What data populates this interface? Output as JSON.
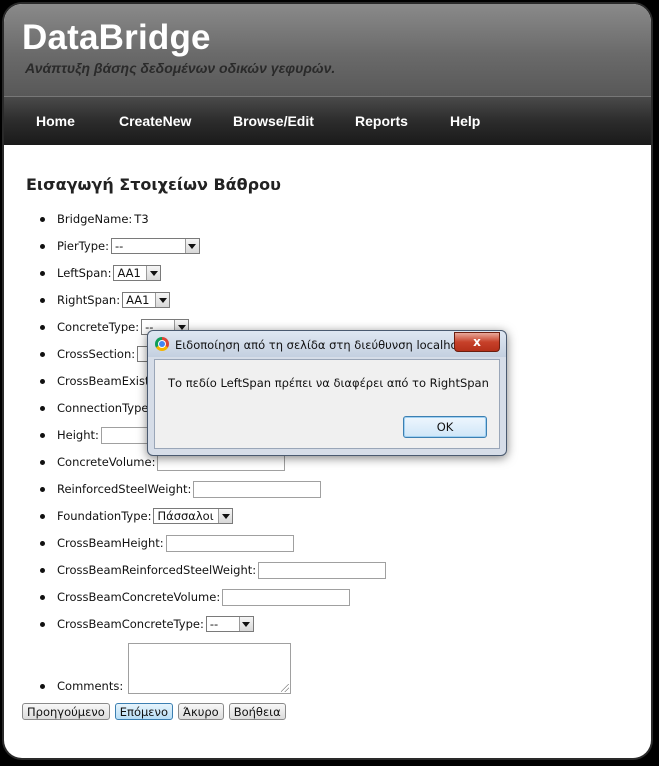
{
  "site": {
    "title": "DataBridge",
    "subtitle": "Ανάπτυξη βάσης δεδομένων οδικών γεφυρών."
  },
  "nav": {
    "items": [
      "Home",
      "CreateNew",
      "Browse/Edit",
      "Reports",
      "Help"
    ]
  },
  "page": {
    "title": "Εισαγωγή Στοιχείων Βάθρου"
  },
  "form": {
    "bridge_name_label": "BridgeName:",
    "bridge_name_value": "T3",
    "pier_type_label": "PierType:",
    "pier_type_value": "--",
    "left_span_label": "LeftSpan:",
    "left_span_value": "AA1",
    "right_span_label": "RightSpan:",
    "right_span_value": "AA1",
    "concrete_type_label": "ConcreteType:",
    "concrete_type_value": "--",
    "cross_section_label": "CrossSection:",
    "cross_beam_exists_label": "CrossBeamExists",
    "connection_type_label": "ConnectionType",
    "height_label": "Height:",
    "concrete_volume_label": "ConcreteVolume:",
    "reinforced_steel_weight_label": "ReinforcedSteelWeight:",
    "foundation_type_label": "FoundationType:",
    "foundation_type_value": "Πάσσαλοι",
    "cross_beam_height_label": "CrossBeamHeight:",
    "cross_beam_reinforced_steel_weight_label": "CrossBeamReinforcedSteelWeight:",
    "cross_beam_concrete_volume_label": "CrossBeamConcreteVolume:",
    "cross_beam_concrete_type_label": "CrossBeamConcreteType:",
    "cross_beam_concrete_type_value": "--",
    "comments_label": "Comments:"
  },
  "buttons": {
    "previous": "Προηγούμενο",
    "next": "Επόμενο",
    "cancel": "Άκυρο",
    "help": "Βοήθεια"
  },
  "dialog": {
    "title": "Ειδοποίηση από τη σελίδα στη διεύθυνση localho...",
    "message": "Το πεδίο LeftSpan πρέπει να διαφέρει από το RightSpan",
    "ok_label": "OK",
    "close_label": "x"
  },
  "colors": {
    "header_bg": "#6f6f6f",
    "nav_bg": "#2c2c2c",
    "page_bg": "#ffffff",
    "dialog_frame": "#d6dde8",
    "close_button": "#c7412a"
  }
}
